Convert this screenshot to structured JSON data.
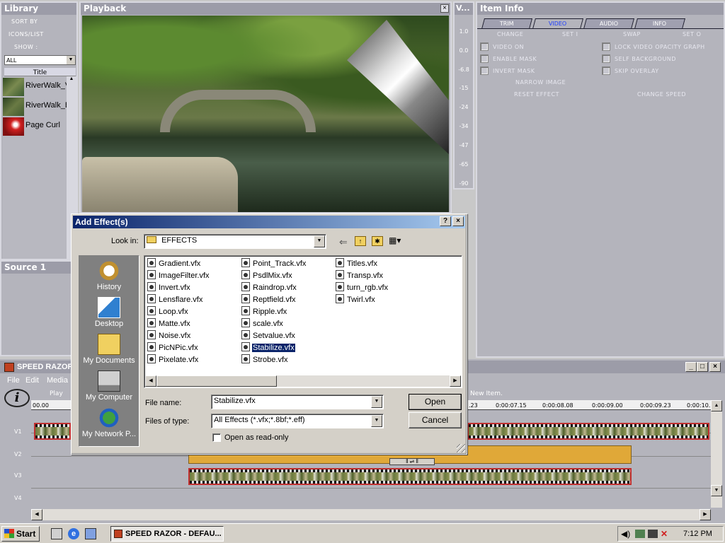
{
  "library": {
    "title": "Library",
    "sort_by": "SORT BY",
    "icons_list": "ICONS/LIST",
    "show": "SHOW :",
    "filter_value": "ALL",
    "column_title": "Title",
    "items": [
      {
        "label": "RiverWalk_V"
      },
      {
        "label": "RiverWalk_B"
      },
      {
        "label": "Page Curl"
      }
    ]
  },
  "playback": {
    "title": "Playback"
  },
  "vu_meter": {
    "title": "V...",
    "levels": [
      "1.0",
      "0.0",
      "-6.8",
      "-15",
      "-24",
      "-34",
      "-47",
      "-65",
      "-90"
    ]
  },
  "item_info": {
    "title": "Item Info",
    "tabs": [
      {
        "label": "TRIM",
        "active": false
      },
      {
        "label": "VIDEO",
        "active": true
      },
      {
        "label": "AUDIO",
        "active": false
      },
      {
        "label": "INFO",
        "active": false
      }
    ],
    "actions": [
      "CHANGE",
      "SET I",
      "SWAP",
      "SET O"
    ],
    "checkboxes_left": [
      "VIDEO ON",
      "ENABLE MASK",
      "INVERT MASK"
    ],
    "checkboxes_right": [
      "LOCK VIDEO OPACITY GRAPH",
      "SELF BACKGROUND",
      "SKIP OVERLAY"
    ],
    "narrow_image": "NARROW IMAGE",
    "reset_effect": "RESET EFFECT",
    "change_speed": "CHANGE SPEED"
  },
  "source": {
    "title": "Source 1"
  },
  "speed_razor": {
    "title": "SPEED RAZOR",
    "menu": [
      "File",
      "Edit",
      "Media"
    ],
    "play_label": "Play",
    "new_item": "New Item.",
    "ruler_left": "00.00",
    "timecodes": [
      ".23",
      "0:00:07.15",
      "0:00:08.08",
      "0:00:09.00",
      "0:00:09.23",
      "0:00:10."
    ],
    "tracks": [
      "V1",
      "V2",
      "V3",
      "V4"
    ]
  },
  "dialog": {
    "title": "Add Effect(s)",
    "help_btn": "?",
    "close_btn": "×",
    "look_in_label": "Look in:",
    "look_in_value": "EFFECTS",
    "places": [
      "History",
      "Desktop",
      "My Documents",
      "My Computer",
      "My Network P..."
    ],
    "files_col1": [
      "Gradient.vfx",
      "ImageFilter.vfx",
      "Invert.vfx",
      "Lensflare.vfx",
      "Loop.vfx",
      "Matte.vfx",
      "Noise.vfx",
      "PicNPic.vfx",
      "Pixelate.vfx"
    ],
    "files_col2": [
      "Point_Track.vfx",
      "PsdlMix.vfx",
      "Raindrop.vfx",
      "Reptfield.vfx",
      "Ripple.vfx",
      "scale.vfx",
      "Setvalue.vfx",
      "Stabilize.vfx",
      "Strobe.vfx"
    ],
    "files_col3": [
      "Titles.vfx",
      "Transp.vfx",
      "turn_rgb.vfx",
      "Twirl.vfx"
    ],
    "selected_file": "Stabilize.vfx",
    "file_name_label": "File name:",
    "file_name_value": "Stabilize.vfx",
    "files_of_type_label": "Files of type:",
    "files_of_type_value": "All Effects (*.vfx;*.8bf;*.eff)",
    "read_only_label": "Open as read-only",
    "open_btn": "Open",
    "cancel_btn": "Cancel"
  },
  "taskbar": {
    "start": "Start",
    "task": "SPEED RAZOR - DEFAU...",
    "clock": "7:12 PM"
  },
  "colors": {
    "selection": "#0a246a",
    "dialog_bg": "#d4d0c8",
    "panel_bg": "#b4b4bc",
    "title_gradient_start": "#0a246a"
  }
}
